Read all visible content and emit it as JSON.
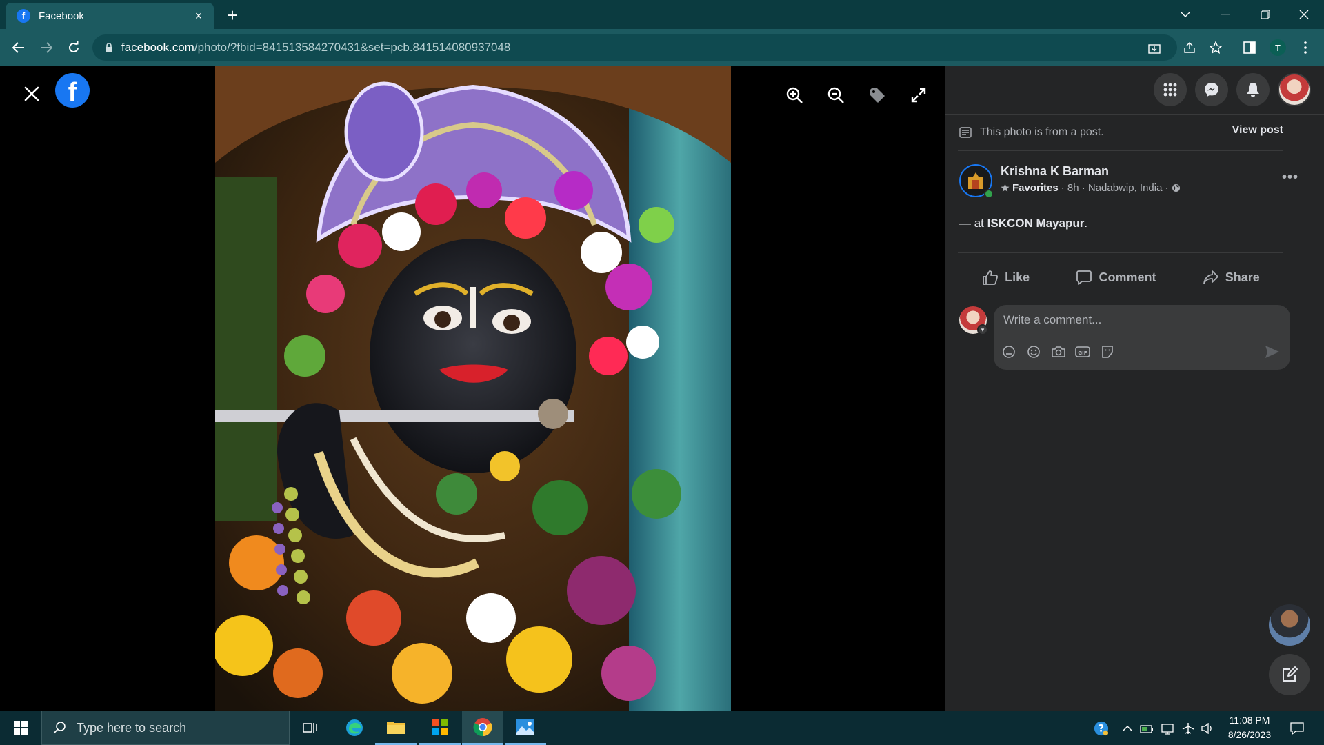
{
  "browser": {
    "tab_title": "Facebook",
    "tab_favicon": "f",
    "new_tab_label": "+",
    "tab_close_label": "×",
    "url_host": "facebook.com",
    "url_path": "/photo/?fbid=841513584270431&set=pcb.841514080937048",
    "profile_initial": "T"
  },
  "viewer": {
    "logo_letter": "f"
  },
  "panel": {
    "post_note": "This photo is from a post.",
    "view_post": "View post",
    "author_name": "Krishna K Barman",
    "author_list": "Favorites",
    "author_meta": "· 8h · Nadabwip, India ·",
    "post_prefix": "— at",
    "post_place": "ISKCON Mayapur",
    "post_suffix": ".",
    "more_label": "•••",
    "actions": {
      "like": "Like",
      "comment": "Comment",
      "share": "Share"
    },
    "comment_placeholder": "Write a comment..."
  },
  "taskbar": {
    "search_placeholder": "Type here to search",
    "time": "11:08 PM",
    "date": "8/26/2023"
  },
  "colors": {
    "facebook_blue": "#1877f2",
    "panel_bg": "#242526",
    "chrome_title": "#0b3b40",
    "chrome_toolbar": "#1c5a60"
  }
}
